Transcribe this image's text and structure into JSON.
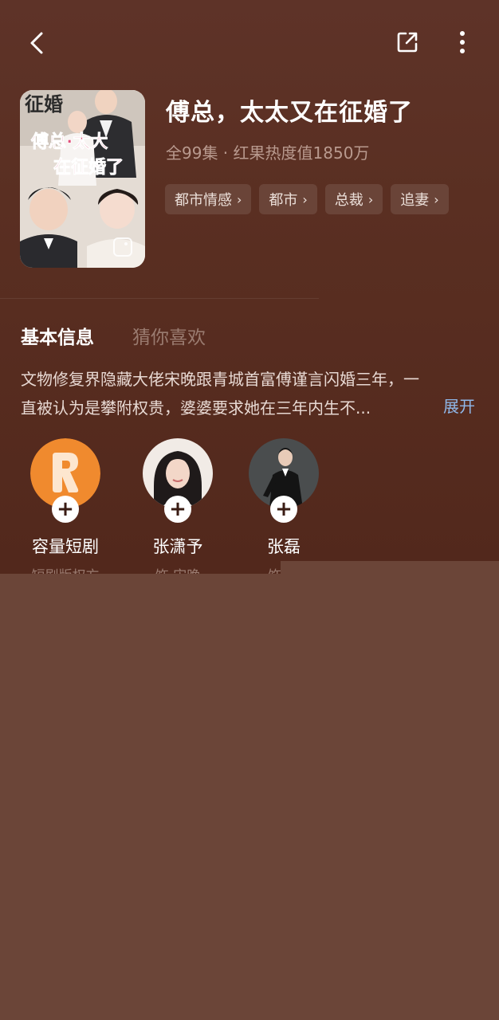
{
  "show": {
    "title": "傅总，太太又在征婚了",
    "meta": "全99集 · 红果热度值1850万",
    "tags": [
      "都市情感",
      "都市",
      "总裁",
      "追妻"
    ]
  },
  "poster": {
    "top_text": "征婚",
    "title_line1": "傅总·太大",
    "title_line2": "在征婚了"
  },
  "tabs": {
    "basic": "基本信息",
    "guess": "猜你喜欢"
  },
  "description": {
    "line1": "文物修复界隐藏大佬宋晚跟青城首富傅谨言闪婚三年，一",
    "line2": "直被认为是攀附权贵，婆婆要求她在三年内生不...",
    "expand": "展开"
  },
  "cast": [
    {
      "name": "容量短剧",
      "role": "短剧版权方",
      "avatar_icon": "brand-logo-icon"
    },
    {
      "name": "张潇予",
      "role": "饰 宋晚",
      "avatar_icon": "actress-photo"
    },
    {
      "name": "张磊",
      "role": "饰 傅",
      "avatar_icon": "actor-photo"
    }
  ],
  "colors": {
    "background": "#5a2f22",
    "lower_fill": "#6b4538",
    "link": "#8fb7e8",
    "brand_orange": "#f08a2e"
  },
  "icons": {
    "back": "chevron-left-icon",
    "share": "share-icon",
    "more": "more-vertical-icon",
    "follow": "plus-icon"
  }
}
